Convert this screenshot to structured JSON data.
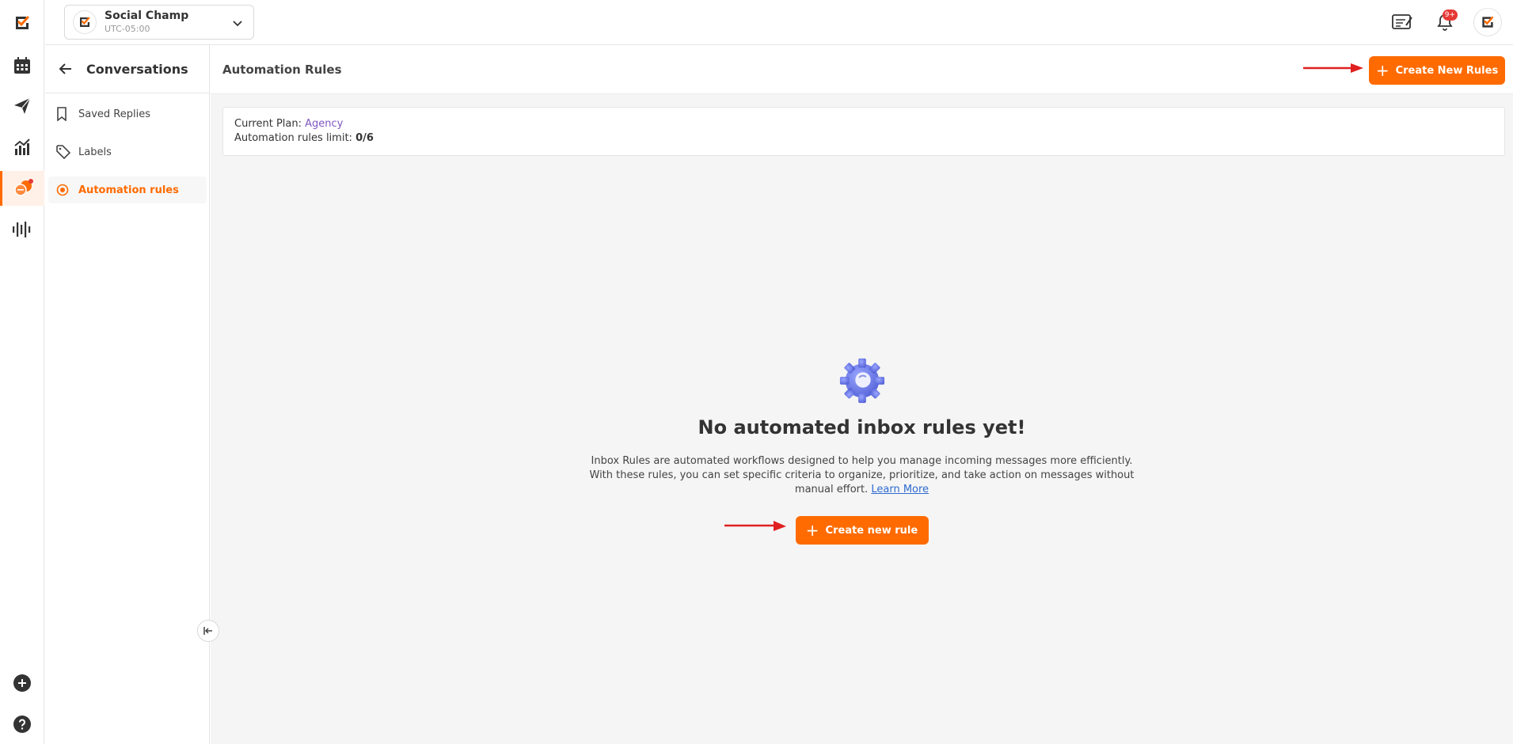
{
  "workspace": {
    "name": "Social Champ",
    "timezone": "UTC-05:00"
  },
  "notifications": {
    "badge": "9+"
  },
  "sidebar": {
    "title": "Conversations",
    "items": [
      {
        "label": "Saved Replies",
        "icon": "bookmark-icon"
      },
      {
        "label": "Labels",
        "icon": "tag-icon"
      },
      {
        "label": "Automation rules",
        "icon": "automation-icon",
        "active": true
      }
    ]
  },
  "main": {
    "title": "Automation Rules",
    "create_button": "Create New Rules",
    "plan": {
      "label": "Current Plan: ",
      "name": "Agency",
      "limit_label": "Automation rules limit: ",
      "limit_value": "0/6"
    },
    "empty": {
      "icon": "gear-icon",
      "title": "No automated inbox rules yet!",
      "description_1": "Inbox Rules are automated workflows designed to help you manage incoming messages more efficiently. With these rules, you can set specific criteria to organize, prioritize, and take action on messages without manual effort. ",
      "learn_more": "Learn More",
      "button": "Create new rule"
    }
  },
  "colors": {
    "accent": "#ff6b00",
    "plan": "#7e57c2",
    "link": "#2d6bd0",
    "arrow": "#e02020"
  }
}
